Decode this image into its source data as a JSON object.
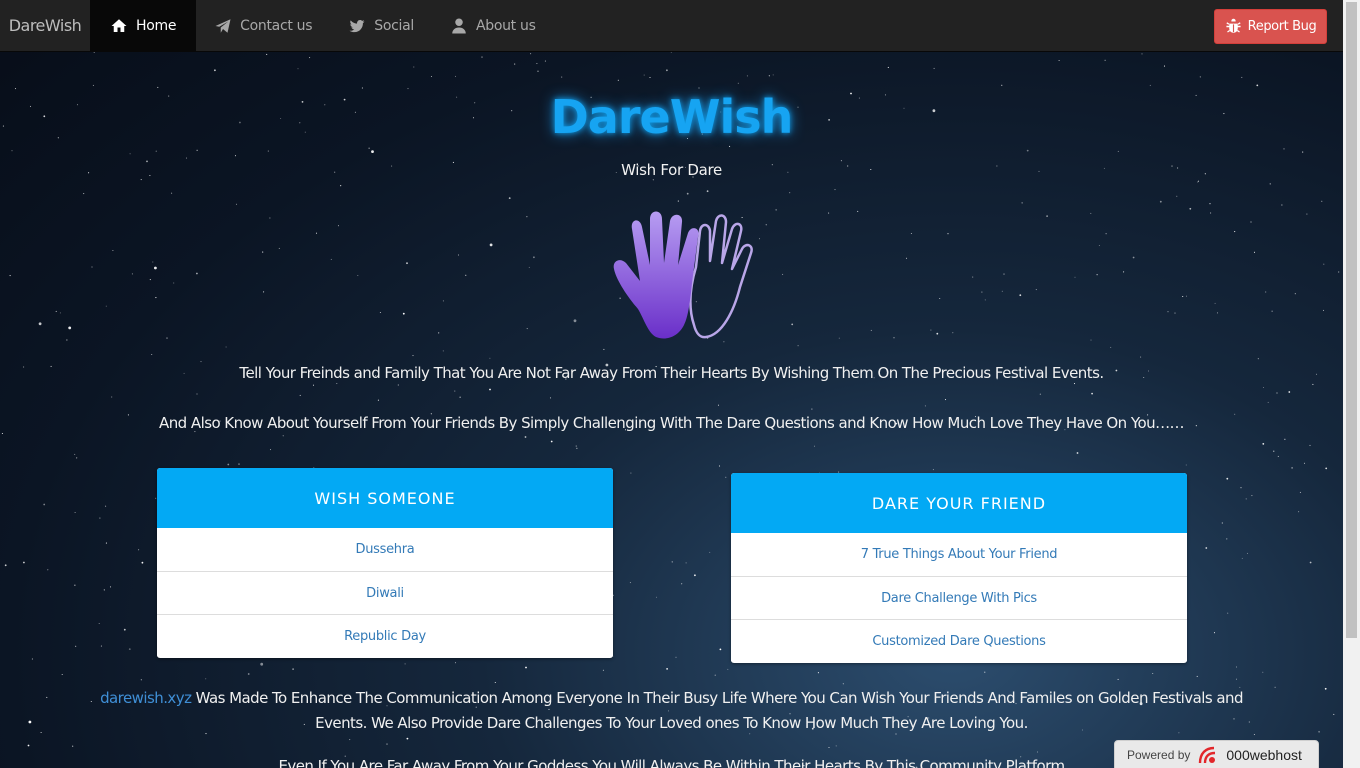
{
  "navbar": {
    "brand": "DareWish",
    "items": [
      {
        "label": "Home",
        "icon": "home-icon",
        "active": true
      },
      {
        "label": "Contact us",
        "icon": "paper-plane-icon",
        "active": false
      },
      {
        "label": "Social",
        "icon": "twitter-icon",
        "active": false
      },
      {
        "label": "About us",
        "icon": "user-icon",
        "active": false
      }
    ],
    "report_button": {
      "label": "Report Bug",
      "icon": "bug-icon"
    }
  },
  "hero": {
    "logo": "DareWish",
    "tagline": "Wish For Dare",
    "paragraph1": "Tell Your Freinds and Family That You Are Not Far Away From Their Hearts By Wishing Them On The Precious Festival Events.",
    "paragraph2": "And Also Know About Yourself From Your Friends By Simply Challenging With The Dare Questions and Know How Much Love They Have On You……"
  },
  "wish_card": {
    "title": "WISH SOMEONE",
    "items": [
      "Dussehra",
      "Diwali",
      "Republic Day"
    ]
  },
  "dare_card": {
    "title": "DARE YOUR FRIEND",
    "items": [
      "7 True Things About Your Friend",
      "Dare Challenge With Pics",
      "Customized Dare Questions"
    ]
  },
  "footer": {
    "link": "darewish.xyz",
    "text": " Was Made To Enhance The Communication Among Everyone In Their Busy Life Where You Can Wish Your Friends And Familes on Golden Festivals and Events. We Also Provide Dare Challenges To Your Loved ones  To Know How Much They Are Loving You.",
    "cut_line": "Even If You Are Far Away From Your Goddess You Will Always Be Within Their Hearts By This Community Platform"
  },
  "powered_badge": {
    "prefix": "Powered by",
    "brand": "000webhost"
  },
  "colors": {
    "accent": "#03a9f4",
    "logo": "#16a4f2",
    "danger": "#d9534f",
    "link": "#337ab7",
    "navbar": "#222222"
  }
}
